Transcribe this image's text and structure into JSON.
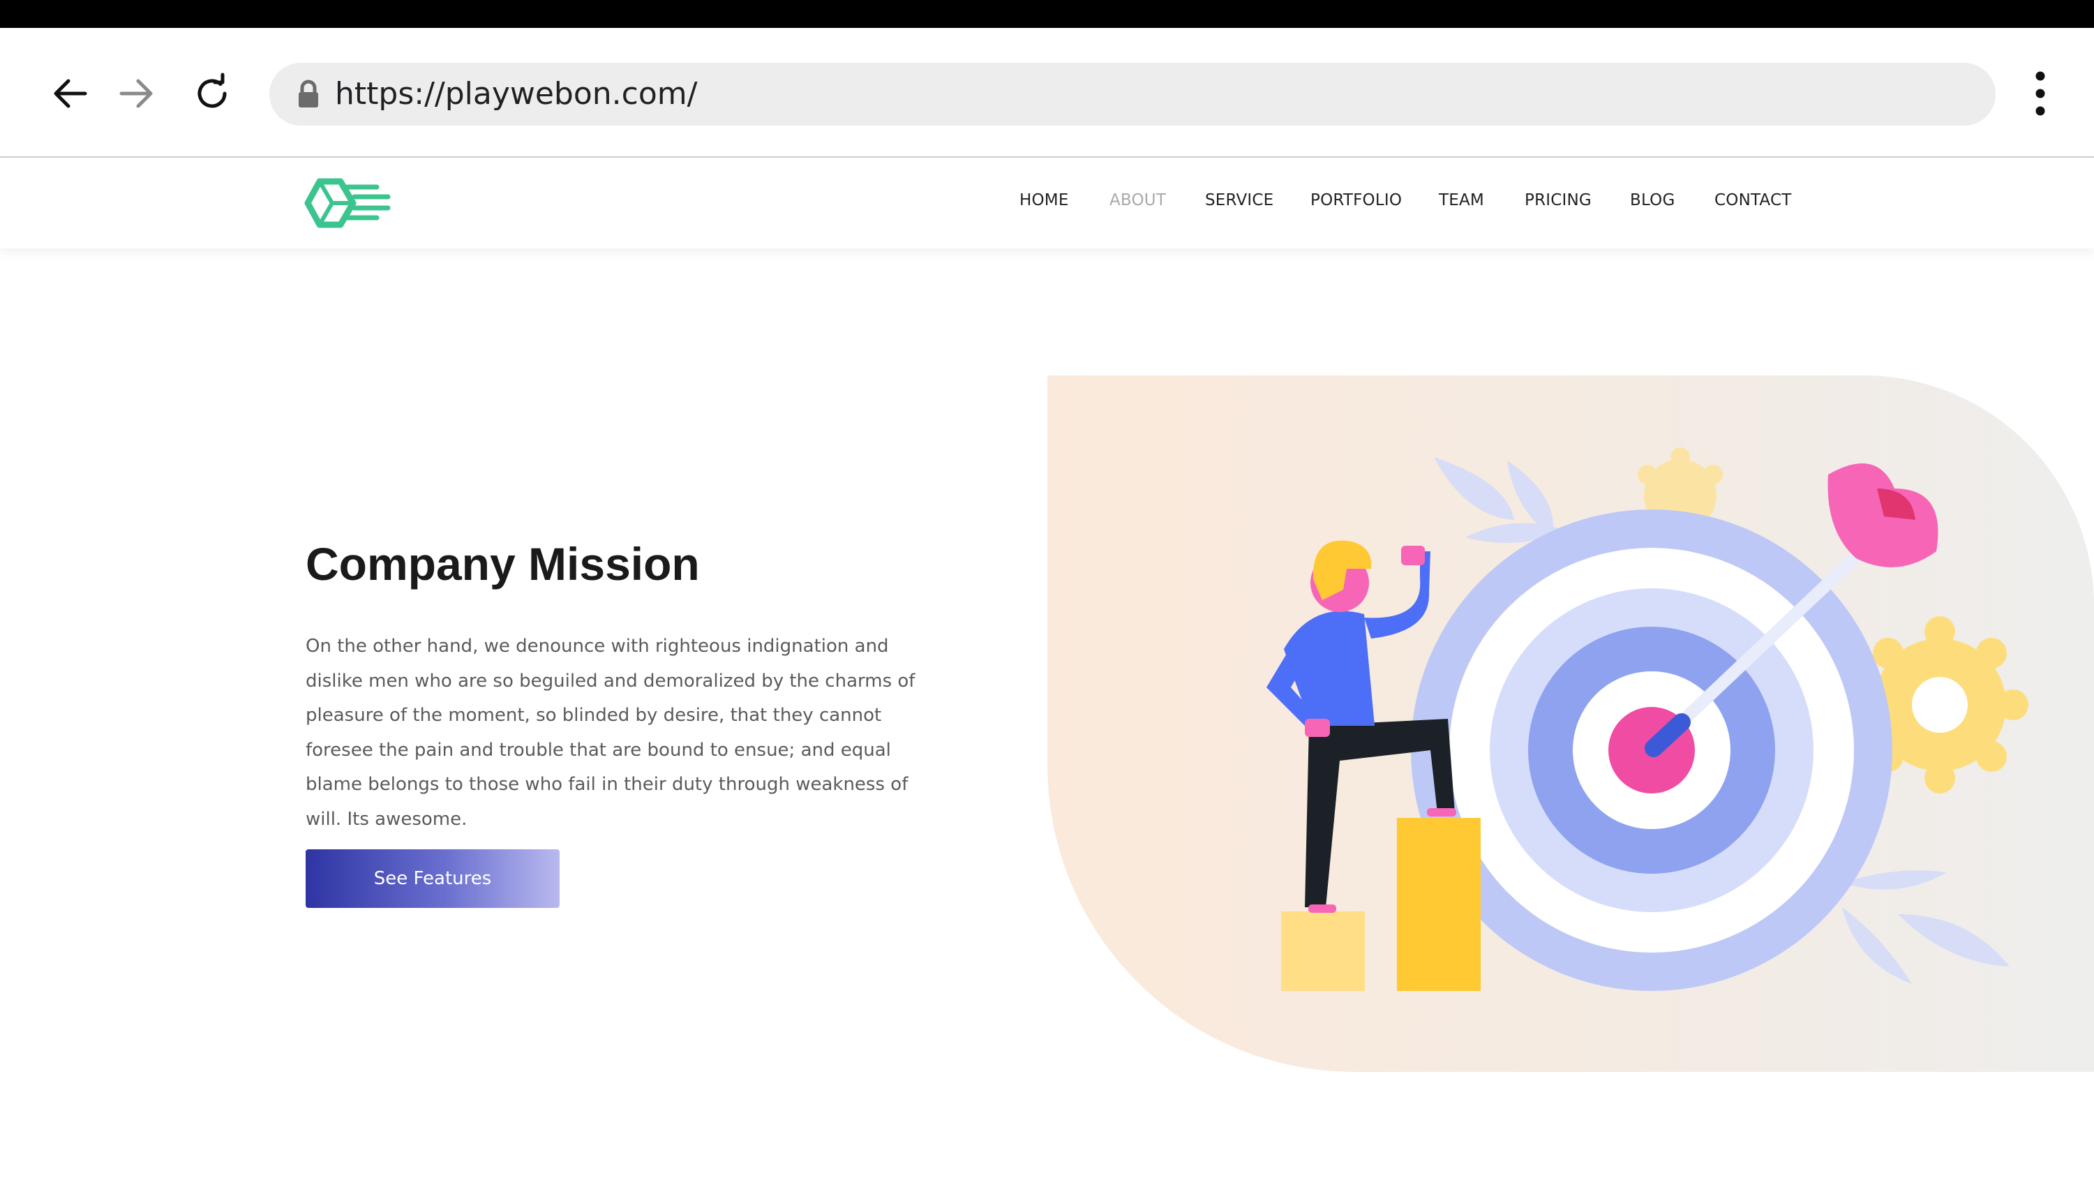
{
  "browser": {
    "url": "https://playwebon.com/"
  },
  "nav": {
    "items": [
      {
        "label": "HOME"
      },
      {
        "label": "ABOUT"
      },
      {
        "label": "SERVICE"
      },
      {
        "label": "PORTFOLIO"
      },
      {
        "label": "TEAM"
      },
      {
        "label": "PRICING"
      },
      {
        "label": "BLOG"
      },
      {
        "label": "CONTACT"
      }
    ],
    "active": "ABOUT"
  },
  "hero": {
    "title": "Company Mission",
    "body": "On the other hand, we denounce with righteous indignation and dislike men who are so beguiled and demoralized by the charms of pleasure of the moment, so blinded by desire, that they cannot foresee the pain and trouble that are bound to ensue; and equal blame belongs to those who fail in their duty through weakness of will. Its awesome.",
    "cta_label": "See Features"
  },
  "colors": {
    "brand_green": "#3cc48e",
    "cta_gradient_start": "#2e35a3",
    "cta_gradient_end": "#b9b9ef",
    "active_nav": "#a9a9a9"
  },
  "icons": {
    "back": "arrow-left-icon",
    "forward": "arrow-right-icon",
    "reload": "reload-icon",
    "lock": "lock-icon",
    "menu": "more-vert-icon"
  }
}
